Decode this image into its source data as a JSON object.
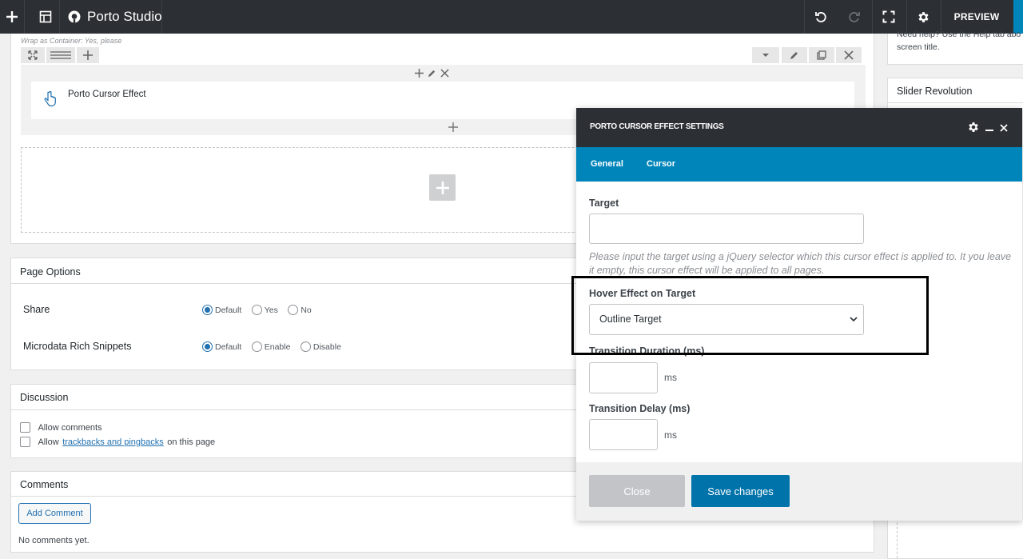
{
  "topbar": {
    "brand": "Porto Studio",
    "preview_label": "PREVIEW",
    "icons": [
      "plus-icon",
      "layout-icon",
      "porto-logo-icon",
      "undo-icon",
      "redo-icon",
      "fullscreen-icon",
      "gear-icon"
    ]
  },
  "builder": {
    "wrap_note": "Wrap as Container: Yes, please",
    "element_name": "Porto Cursor Effect"
  },
  "page_options": {
    "title": "Page Options",
    "share": {
      "label": "Share",
      "options": [
        "Default",
        "Yes",
        "No"
      ],
      "selected": "Default"
    },
    "microdata": {
      "label": "Microdata Rich Snippets",
      "options": [
        "Default",
        "Enable",
        "Disable"
      ],
      "selected": "Default"
    }
  },
  "discussion": {
    "title": "Discussion",
    "allow_comments": "Allow comments",
    "allow_prefix": "Allow",
    "trackbacks_link": "trackbacks and pingbacks",
    "allow_suffix": "on this page"
  },
  "comments": {
    "title": "Comments",
    "add_button": "Add Comment",
    "empty": "No comments yet."
  },
  "sidebar": {
    "help_text_line1": "Need help? Use the Help tab abo",
    "help_text_line2": "screen title.",
    "slider_title": "Slider Revolution"
  },
  "modal": {
    "title": "PORTO CURSOR EFFECT SETTINGS",
    "tabs": [
      "General",
      "Cursor"
    ],
    "active_tab": "General",
    "target_label": "Target",
    "target_value": "",
    "target_help": "Please input the target using a jQuery selector which this cursor effect is applied to. It you leave it empty, this cursor effect will be applied to all pages.",
    "hover_label": "Hover Effect on Target",
    "hover_value": "Outline Target",
    "duration_label": "Transition Duration (ms)",
    "duration_unit": "ms",
    "delay_label": "Transition Delay (ms)",
    "delay_unit": "ms",
    "close_label": "Close",
    "save_label": "Save changes"
  },
  "colors": {
    "topbar": "#2c2f34",
    "accent": "#0085ba",
    "save_button": "#0073aa",
    "close_button": "#c3c4c7"
  }
}
